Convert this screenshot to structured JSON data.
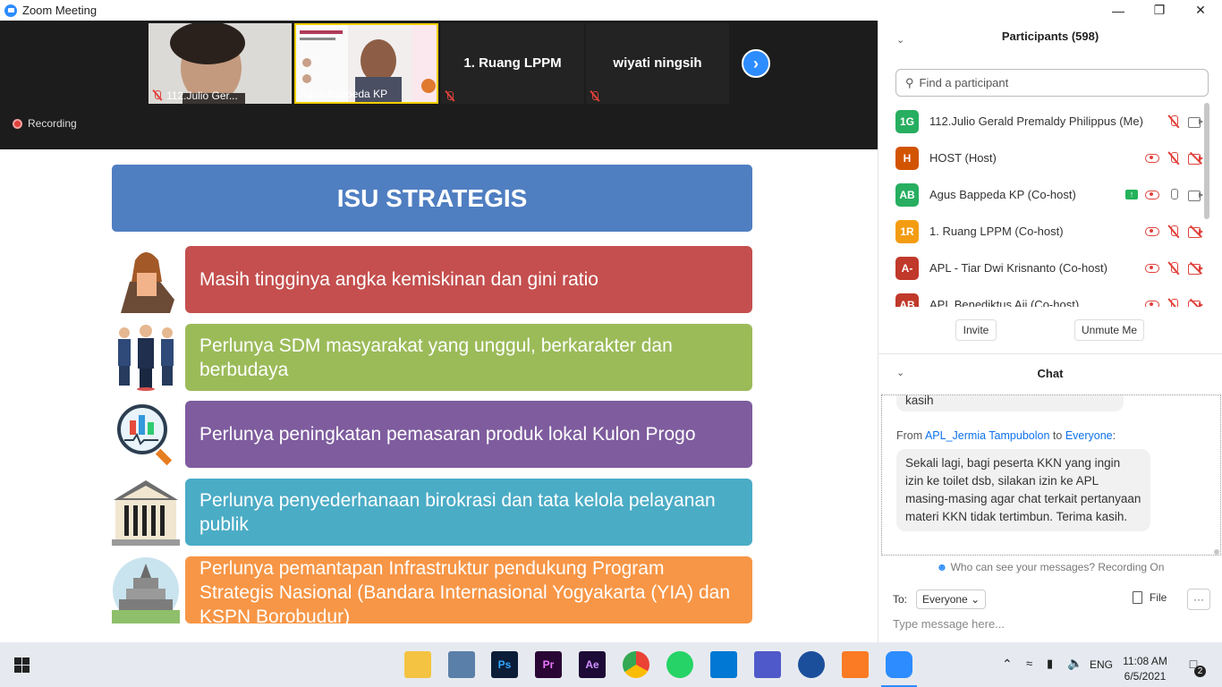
{
  "window": {
    "title": "Zoom Meeting"
  },
  "video_strip": {
    "tiles": [
      {
        "name": "112.Julio Ger..."
      },
      {
        "name": "Agus Bappeda KP"
      },
      {
        "name": "1. Ruang LPPM"
      },
      {
        "name": "wiyati ningsih"
      }
    ],
    "recording_label": "Recording"
  },
  "slide": {
    "title": "ISU STRATEGIS",
    "items": [
      {
        "text": "Masih tingginya angka kemiskinan dan gini ratio",
        "color": "#c44f4e"
      },
      {
        "text": "Perlunya  SDM masyarakat yang unggul, berkarakter dan berbudaya",
        "color": "#9bbb59"
      },
      {
        "text": "Perlunya peningkatan pemasaran produk lokal Kulon Progo",
        "color": "#7e5c9e"
      },
      {
        "text": "Perlunya penyederhanaan birokrasi  dan tata kelola pelayanan publik",
        "color": "#4bacc6"
      },
      {
        "text": "Perlunya pemantapan Infrastruktur pendukung Program Strategis Nasional (Bandara Internasional Yogyakarta (YIA) dan KSPN Borobudur)",
        "color": "#f79646"
      }
    ]
  },
  "participants": {
    "title": "Participants (598)",
    "search_placeholder": "Find a participant",
    "list": [
      {
        "initials": "1G",
        "name": "112.Julio Gerald Premaldy Philippus (Me)",
        "color": "#27ae60"
      },
      {
        "initials": "H",
        "name": "HOST (Host)",
        "color": "#d35400"
      },
      {
        "initials": "AB",
        "name": "Agus Bappeda KP (Co-host)",
        "color": "#27ae60"
      },
      {
        "initials": "1R",
        "name": "1. Ruang LPPM (Co-host)",
        "color": "#f39c12"
      },
      {
        "initials": "A-",
        "name": "APL - Tiar Dwi Krisnanto (Co-host)",
        "color": "#c0392b"
      },
      {
        "initials": "AB",
        "name": "APL Benediktus Aji (Co-host)",
        "color": "#c0392b"
      }
    ],
    "invite_label": "Invite",
    "unmute_label": "Unmute Me"
  },
  "chat": {
    "title": "Chat",
    "prev_message_tail": "kasih",
    "from_prefix": "From",
    "from_name": "APL_Jermia Tampubolon",
    "to_word": "to",
    "to_name": "Everyone",
    "message": "Sekali lagi, bagi peserta KKN yang ingin izin ke toilet dsb, silakan izin ke APL masing-masing agar chat terkait pertanyaan materi KKN tidak tertimbun. Terima kasih.",
    "who_can_see": "Who can see your messages? Recording On",
    "to_label": "To:",
    "recipient": "Everyone",
    "file_label": "File",
    "more_label": "···",
    "input_placeholder": "Type message here..."
  },
  "taskbar": {
    "time": "11:08 AM",
    "date": "6/5/2021",
    "lang": "ENG",
    "notifications": "2",
    "apps": [
      "file-explorer",
      "photos",
      "Ps",
      "Pr",
      "Ae",
      "chrome",
      "whatsapp",
      "vscode",
      "teams",
      "app",
      "xampp",
      "zoom"
    ]
  }
}
